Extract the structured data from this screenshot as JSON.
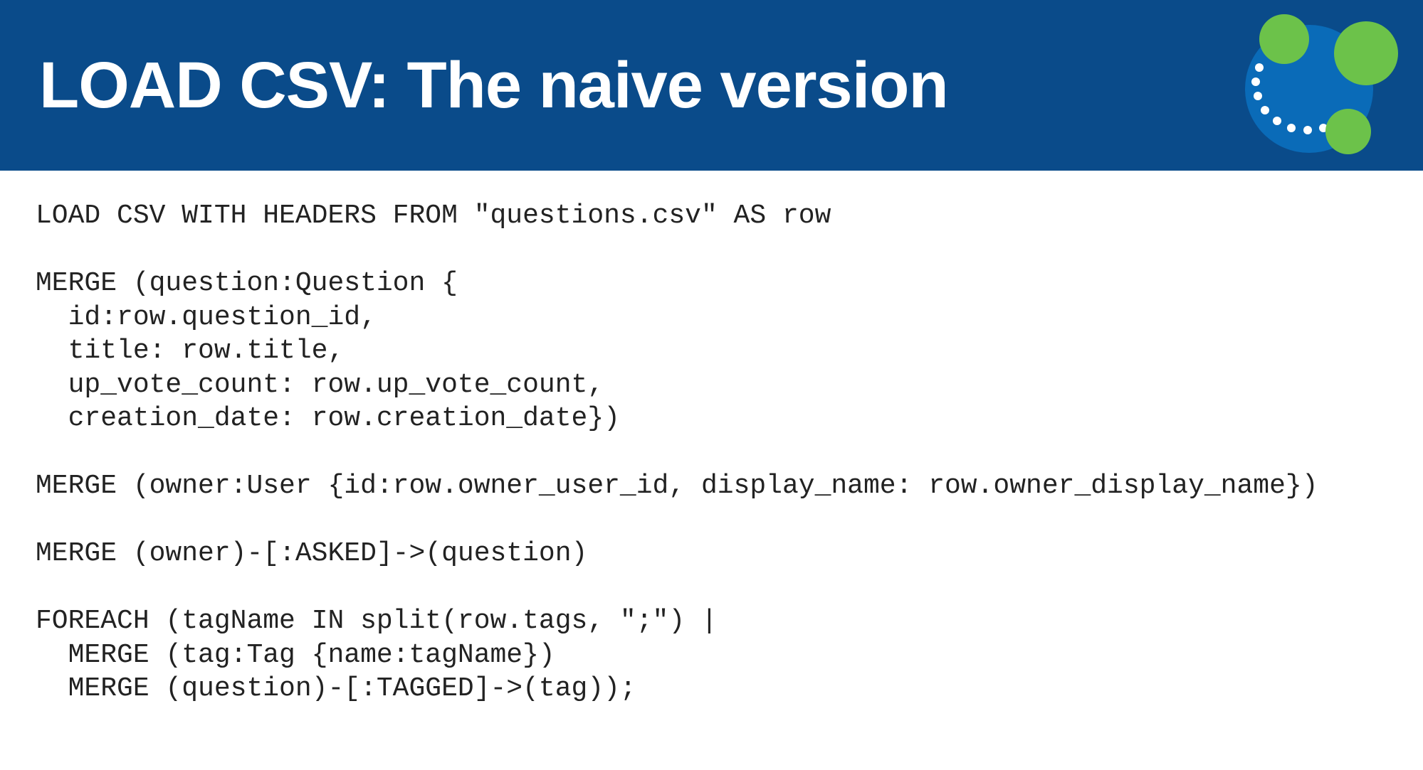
{
  "header": {
    "title": "LOAD CSV: The naive version"
  },
  "code": {
    "lines": [
      "LOAD CSV WITH HEADERS FROM \"questions.csv\" AS row",
      "",
      "MERGE (question:Question {",
      "  id:row.question_id,",
      "  title: row.title,",
      "  up_vote_count: row.up_vote_count,",
      "  creation_date: row.creation_date})",
      "",
      "MERGE (owner:User {id:row.owner_user_id, display_name: row.owner_display_name})",
      "",
      "MERGE (owner)-[:ASKED]->(question)",
      "",
      "FOREACH (tagName IN split(row.tags, \";\") |",
      "  MERGE (tag:Tag {name:tagName})",
      "  MERGE (question)-[:TAGGED]->(tag));"
    ]
  },
  "logo": {
    "name": "neo4j-logo"
  }
}
